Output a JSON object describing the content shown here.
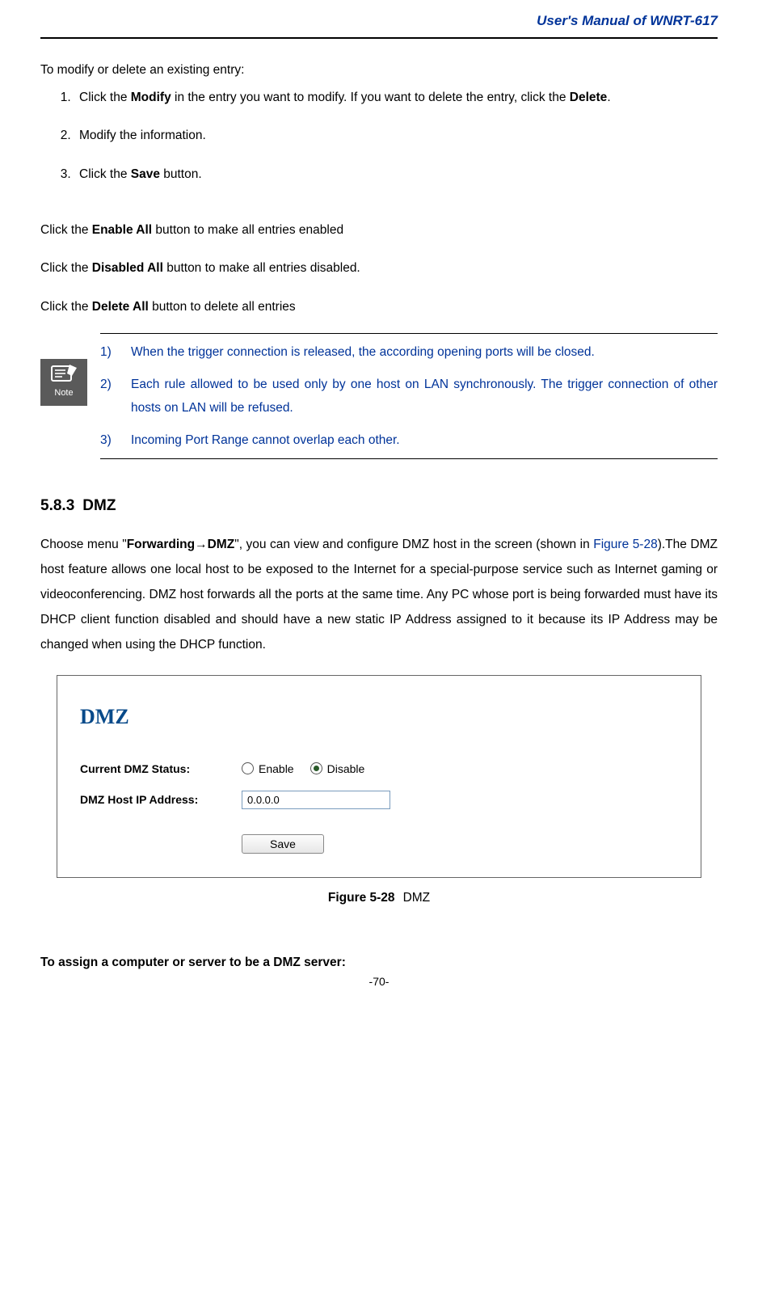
{
  "header": {
    "title": "User's  Manual  of  WNRT-617"
  },
  "modify": {
    "intro": "To modify or delete an existing entry:",
    "steps": {
      "s1a": "Click the ",
      "s1b": "Modify",
      "s1c": " in the entry you want to modify. If you want to delete the entry, click the ",
      "s1d": "Delete",
      "s1e": ".",
      "s2": "Modify the information.",
      "s3a": "Click the ",
      "s3b": "Save",
      "s3c": " button."
    },
    "click1a": "Click the ",
    "click1b": "Enable All",
    "click1c": " button to make all entries enabled",
    "click2a": "Click the ",
    "click2b": "Disabled All",
    "click2c": " button to make all entries disabled.",
    "click3a": "Click the ",
    "click3b": "Delete All",
    "click3c": " button to delete all entries"
  },
  "note": {
    "label": "Note",
    "n1": "1)",
    "t1": "When the trigger connection is released, the according opening ports will be closed.",
    "n2": "2)",
    "t2": "Each rule allowed to be used only by one host on LAN synchronously. The trigger connection of other hosts on LAN will be refused.",
    "n3": "3)",
    "t3": "Incoming Port Range cannot overlap each other."
  },
  "section": {
    "num": "5.8.3",
    "title": "DMZ"
  },
  "dmz": {
    "p1a": "Choose menu \"",
    "p1b": "Forwarding→DMZ",
    "p1c": "\", you can view and configure DMZ host in the screen (shown in ",
    "figref": "Figure 5-28",
    "p1d": ").The DMZ host feature allows one local host to be exposed to the Internet for a special-purpose service such as Internet gaming or videoconferencing. DMZ host forwards all the ports at the same time. Any PC whose port is being forwarded must have its DHCP client function disabled and should have a new static IP Address assigned to it because its IP Address may be changed when using the DHCP function."
  },
  "screenshot": {
    "heading": "DMZ",
    "statusLabel": "Current DMZ Status:",
    "enable": "Enable",
    "disable": "Disable",
    "ipLabel": "DMZ Host IP Address:",
    "ipValue": "0.0.0.0",
    "save": "Save"
  },
  "caption": {
    "fig": "Figure 5-28",
    "text": "DMZ"
  },
  "assign": "To assign a computer or server to be a DMZ server:",
  "pageNumber": "-70-"
}
